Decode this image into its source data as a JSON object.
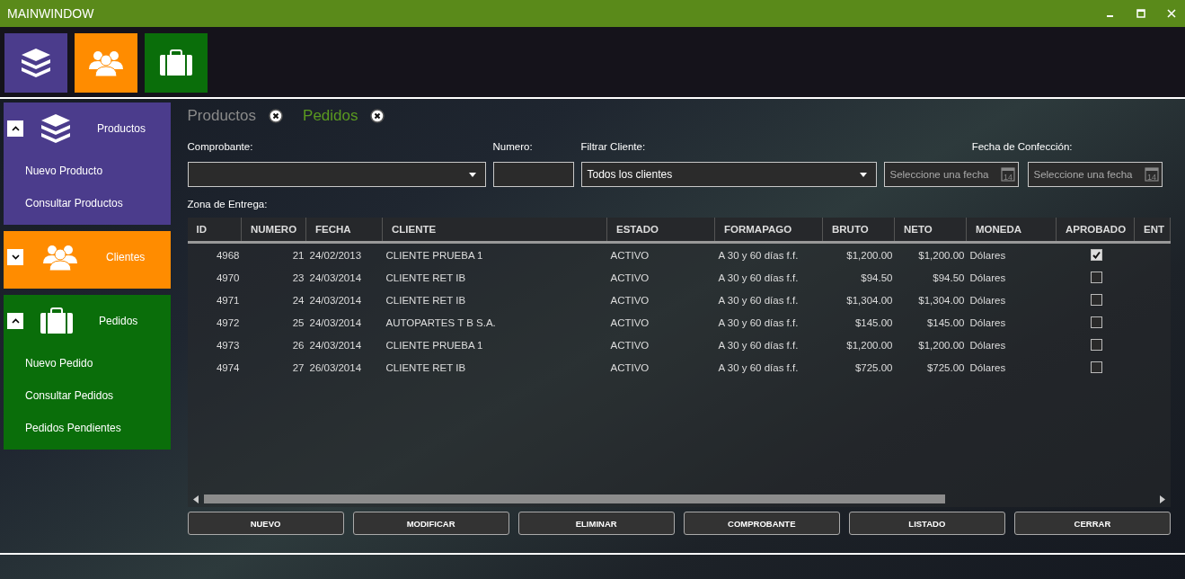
{
  "window": {
    "title": "MAINWINDOW"
  },
  "tiles": [
    {
      "color": "#4b3c8c"
    },
    {
      "color": "#ff8c00"
    },
    {
      "color": "#0a6e0a"
    }
  ],
  "sidebar": {
    "sections": [
      {
        "title": "Productos",
        "color": "#4b3c8c",
        "expanded": true,
        "items": [
          "Nuevo Producto",
          "Consultar Productos"
        ]
      },
      {
        "title": "Clientes",
        "color": "#ff8c00",
        "expanded": false
      },
      {
        "title": "Pedidos",
        "color": "#0a6e0a",
        "expanded": true,
        "items": [
          "Nuevo Pedido",
          "Consultar Pedidos",
          "Pedidos Pendientes"
        ]
      }
    ]
  },
  "tabs": [
    {
      "label": "Productos",
      "selected": false
    },
    {
      "label": "Pedidos",
      "selected": true
    }
  ],
  "filters": {
    "comprobante_label": "Comprobante:",
    "numero_label": "Numero:",
    "cliente_label": "Filtrar Cliente:",
    "cliente_value": "Todos los clientes",
    "fecha_label": "Fecha de Confección:",
    "date_fields": [
      {
        "placeholder": "Seleccione una fecha",
        "calendar_day": "14"
      },
      {
        "placeholder": "Seleccione una fecha",
        "calendar_day": "14"
      }
    ],
    "zona_label": "Zona de Entrega:"
  },
  "table": {
    "columns": [
      "ID",
      "NUMERO",
      "FECHA",
      "CLIENTE",
      "ESTADO",
      "FORMAPAGO",
      "BRUTO",
      "NETO",
      "MONEDA",
      "APROBADO",
      "ENT"
    ],
    "rows": [
      {
        "id": "4968",
        "numero": "21",
        "fecha": "24/02/2013",
        "cliente": "CLIENTE PRUEBA 1",
        "estado": "ACTIVO",
        "formapago": "A 30 y 60 días f.f.",
        "bruto": "$1,200.00",
        "neto": "$1,200.00",
        "moneda": "Dólares",
        "aprobado": true
      },
      {
        "id": "4970",
        "numero": "23",
        "fecha": "24/03/2014",
        "cliente": "CLIENTE RET IB",
        "estado": "ACTIVO",
        "formapago": "A 30 y 60 días f.f.",
        "bruto": "$94.50",
        "neto": "$94.50",
        "moneda": "Dólares",
        "aprobado": false
      },
      {
        "id": "4971",
        "numero": "24",
        "fecha": "24/03/2014",
        "cliente": "CLIENTE RET IB",
        "estado": "ACTIVO",
        "formapago": "A 30 y 60 días f.f.",
        "bruto": "$1,304.00",
        "neto": "$1,304.00",
        "moneda": "Dólares",
        "aprobado": false
      },
      {
        "id": "4972",
        "numero": "25",
        "fecha": "24/03/2014",
        "cliente": "AUTOPARTES T B S.A.",
        "estado": "ACTIVO",
        "formapago": "A 30 y 60 días f.f.",
        "bruto": "$145.00",
        "neto": "$145.00",
        "moneda": "Dólares",
        "aprobado": false
      },
      {
        "id": "4973",
        "numero": "26",
        "fecha": "24/03/2014",
        "cliente": "CLIENTE PRUEBA 1",
        "estado": "ACTIVO",
        "formapago": "A 30 y 60 días f.f.",
        "bruto": "$1,200.00",
        "neto": "$1,200.00",
        "moneda": "Dólares",
        "aprobado": false
      },
      {
        "id": "4974",
        "numero": "27",
        "fecha": "26/03/2014",
        "cliente": "CLIENTE RET IB",
        "estado": "ACTIVO",
        "formapago": "A 30 y 60 días f.f.",
        "bruto": "$725.00",
        "neto": "$725.00",
        "moneda": "Dólares",
        "aprobado": false
      }
    ]
  },
  "buttons": [
    "NUEVO",
    "MODIFICAR",
    "ELIMINAR",
    "COMPROBANTE",
    "LISTADO",
    "CERRAR"
  ]
}
